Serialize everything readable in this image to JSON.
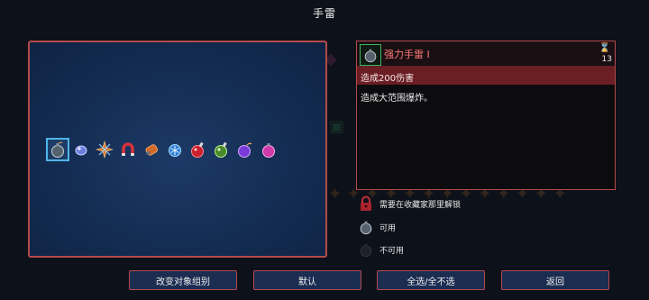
{
  "title": "手雷",
  "items": [
    {
      "icon": "bomb-icon",
      "selected": true
    },
    {
      "icon": "blue-orb-icon"
    },
    {
      "icon": "spike-burst-icon"
    },
    {
      "icon": "red-magnet-icon"
    },
    {
      "icon": "canister-bomb-icon"
    },
    {
      "icon": "ice-bomb-icon"
    },
    {
      "icon": "red-potion-bomb-icon"
    },
    {
      "icon": "green-potion-bomb-icon"
    },
    {
      "icon": "purple-bomb-icon"
    },
    {
      "icon": "pink-bomb-icon"
    }
  ],
  "detail": {
    "name": "强力手雷 I",
    "count": "13",
    "stat": "造成200伤害",
    "description": "造成大范围爆炸。"
  },
  "legend": {
    "locked": "需要在收藏家那里解锁",
    "available": "可用",
    "unavailable": "不可用"
  },
  "buttons": {
    "change_group": "改变对象组别",
    "default": "默认",
    "select_all": "全选/全不选",
    "back": "返回"
  },
  "colors": {
    "frame": "#b44a4a",
    "panel": "#142c52",
    "stat_bar": "#6b1e24"
  }
}
